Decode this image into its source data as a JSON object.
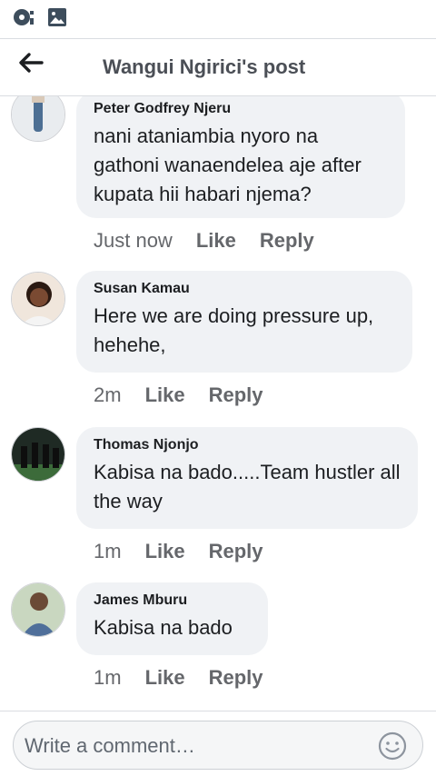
{
  "statusbar": {
    "icons": [
      "mic-record-icon",
      "image-icon"
    ]
  },
  "header": {
    "title": "Wangui Ngirici's post",
    "back_icon": "back-arrow-icon"
  },
  "comments": [
    {
      "author": "Peter Godfrey Njeru",
      "text": "nani ataniambia nyoro na gathoni wanaendelea aje after kupata hii habari njema?",
      "time": "Just now",
      "like": "Like",
      "reply": "Reply"
    },
    {
      "author": "Susan Kamau",
      "text": "Here we are doing pressure up, hehehe,",
      "time": "2m",
      "like": "Like",
      "reply": "Reply"
    },
    {
      "author": "Thomas Njonjo",
      "text": "Kabisa na bado.....Team hustler all the way",
      "time": "1m",
      "like": "Like",
      "reply": "Reply"
    },
    {
      "author": "James Mburu",
      "text": "Kabisa na bado",
      "time": "1m",
      "like": "Like",
      "reply": "Reply"
    }
  ],
  "composer": {
    "placeholder": "Write a comment…",
    "emoji_icon": "smiley-icon"
  },
  "colors": {
    "bubble": "#f0f2f5",
    "meta_text": "#65676b",
    "title_text": "#4b4f56"
  }
}
